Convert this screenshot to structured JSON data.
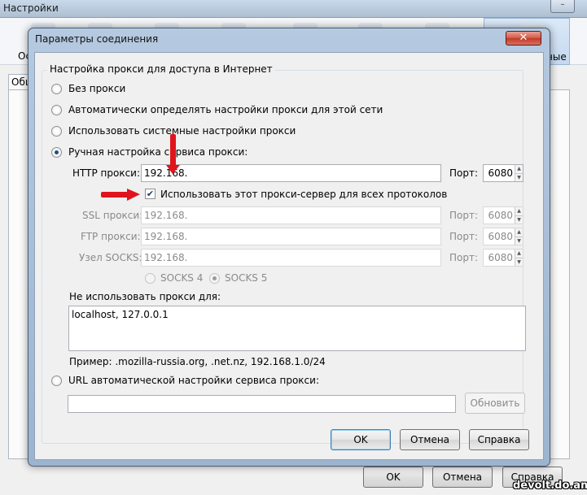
{
  "parent_window": {
    "title": "Настройки",
    "toolbar_first_label": "Ос",
    "toolbar_last_label": "ные",
    "tab_label": "Обш",
    "buttons": {
      "ok": "OK",
      "cancel": "Отмена",
      "help": "Справка"
    }
  },
  "dialog": {
    "title": "Параметры соединения",
    "close_label": "✕",
    "group_title": "Настройка прокси для доступа в Интернет",
    "options": {
      "no_proxy": "Без прокси",
      "auto_detect": "Автоматически определять настройки прокси для этой сети",
      "system": "Использовать системные настройки прокси",
      "manual": "Ручная настройка сервиса прокси:"
    },
    "selected_option": "manual",
    "http": {
      "label": "HTTP прокси:",
      "value": "192.168.",
      "port_label": "Порт:",
      "port": "6080"
    },
    "use_for_all": {
      "label": "Использовать этот прокси-сервер для всех протоколов",
      "checked": true
    },
    "ssl": {
      "label": "SSL прокси:",
      "value": "192.168.",
      "port_label": "Порт:",
      "port": "6080"
    },
    "ftp": {
      "label": "FTP прокси:",
      "value": "192.168.",
      "port_label": "Порт:",
      "port": "6080"
    },
    "socks": {
      "label": "Узел SOCKS:",
      "value": "192.168.",
      "port_label": "Порт:",
      "port": "6080"
    },
    "socks_versions": {
      "v4": "SOCKS 4",
      "v5": "SOCKS 5",
      "selected": "v5"
    },
    "no_proxy_for": {
      "label": "Не использовать прокси для:",
      "value": "localhost, 127.0.0.1"
    },
    "example": "Пример: .mozilla-russia.org, .net.nz, 192.168.1.0/24",
    "auto_url": {
      "label": "URL автоматической настройки сервиса прокси:",
      "value": "",
      "reload_label": "Обновить"
    },
    "buttons": {
      "ok": "OK",
      "cancel": "Отмена",
      "help": "Справка"
    }
  },
  "annotation_color": "#e0141c",
  "watermark": "devolt.do.am"
}
